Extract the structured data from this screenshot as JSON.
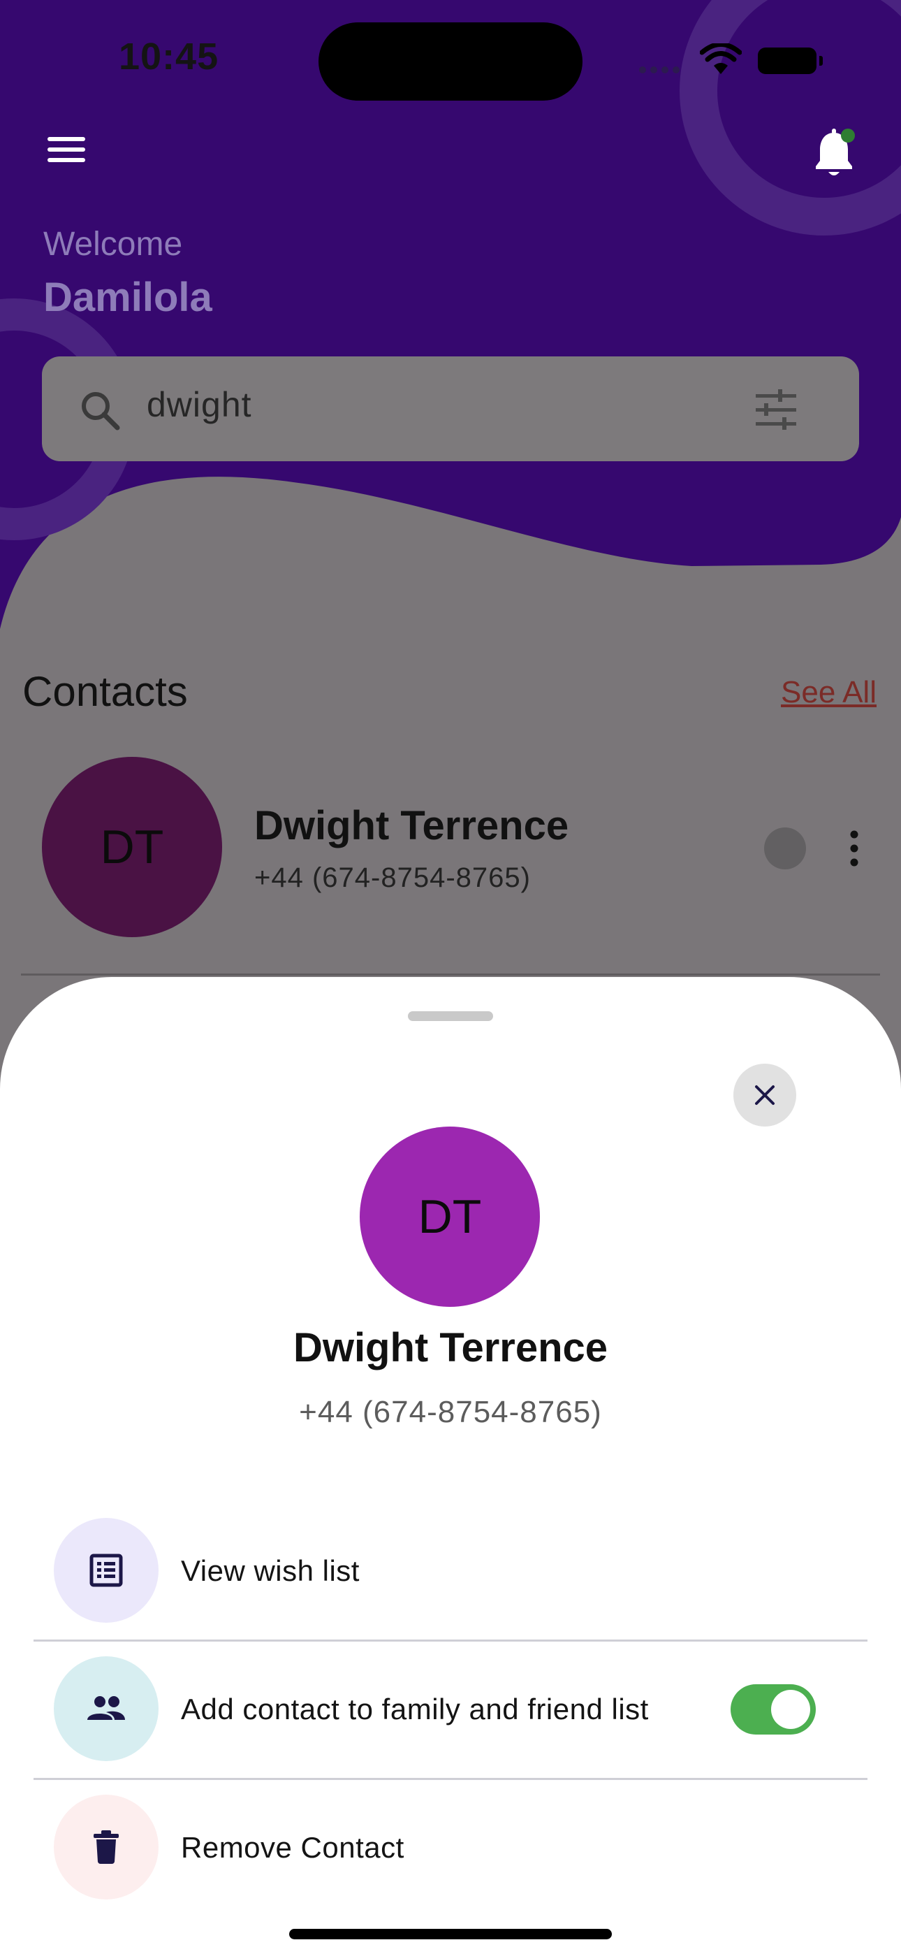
{
  "status_bar": {
    "time": "10:45"
  },
  "header": {
    "welcome_label": "Welcome",
    "user_name": "Damilola",
    "notification_badge_color": "#2e7d32",
    "background_color": "#36086f"
  },
  "search": {
    "value": "dwight"
  },
  "contacts": {
    "title": "Contacts",
    "see_all_label": "See All",
    "items": [
      {
        "initials": "DT",
        "name": "Dwight Terrence",
        "phone": "+44 (674-8754-8765)"
      }
    ]
  },
  "sheet": {
    "initials": "DT",
    "name": "Dwight Terrence",
    "phone": "+44 (674-8754-8765)",
    "options": [
      {
        "label": "View wish list",
        "icon": "list-icon",
        "icon_bg": "#ebe8fb"
      },
      {
        "label": "Add contact to family and friend list",
        "icon": "people-icon",
        "icon_bg": "#d7eef1",
        "toggle_on": true
      },
      {
        "label": "Remove Contact",
        "icon": "trash-icon",
        "icon_bg": "#fdeeee"
      }
    ]
  },
  "colors": {
    "accent_purple": "#9c27b0",
    "toggle_green": "#4caf50",
    "link_red": "#7b2b27"
  }
}
